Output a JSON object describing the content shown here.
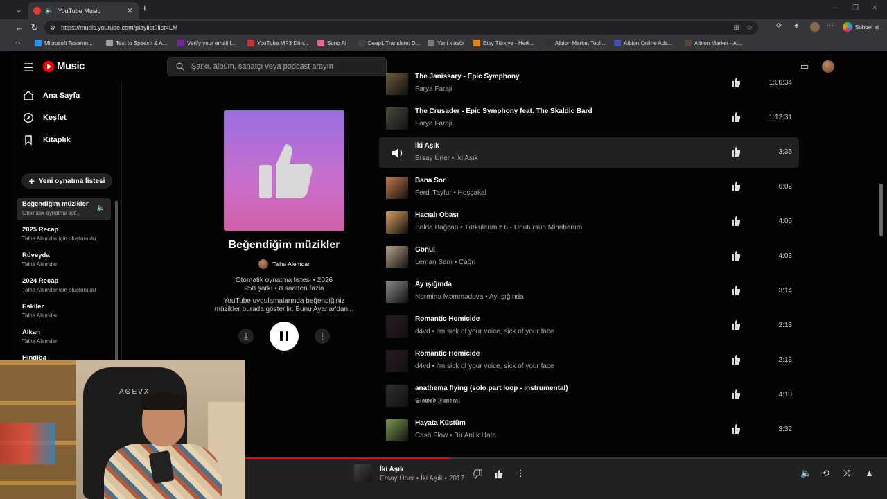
{
  "browser": {
    "tab_title": "YouTube Music",
    "url": "https://music.youtube.com/playlist?list=LM",
    "profile_label": "Sohbet et",
    "bookmarks": [
      {
        "label": "Microsoft Tasarım...",
        "color": "#2196f3"
      },
      {
        "label": "Text to Speech & A...",
        "color": "#9e9e9e"
      },
      {
        "label": "Verify your email f...",
        "color": "#7b1fa2"
      },
      {
        "label": "YouTube MP3 Dön...",
        "color": "#d32f2f"
      },
      {
        "label": "Suno AI",
        "color": "#f06292"
      },
      {
        "label": "DeepL Translate: D...",
        "color": "#424242"
      },
      {
        "label": "Yeni klasör",
        "color": "#757575"
      },
      {
        "label": "Etsy Türkiye - Herk...",
        "color": "#f57c00"
      },
      {
        "label": "Albion Market Tool...",
        "color": "#303030"
      },
      {
        "label": "Albion Online Ada...",
        "color": "#3f51b5"
      },
      {
        "label": "Albion Market - Al...",
        "color": "#5d4037"
      }
    ]
  },
  "app": {
    "logo_text": "Music",
    "search_placeholder": "Şarkı, albüm, sanatçı veya podcast arayın",
    "nav": [
      {
        "label": "Ana Sayfa",
        "icon": "home-icon"
      },
      {
        "label": "Keşfet",
        "icon": "explore-icon"
      },
      {
        "label": "Kitaplık",
        "icon": "library-icon"
      }
    ],
    "new_playlist_label": "Yeni oynatma listesi",
    "playlists": [
      {
        "title": "Beğendiğim müzikler",
        "subtitle": "Otomatik oynatma list...",
        "active": true
      },
      {
        "title": "2025 Recap",
        "subtitle": "Talha Alemdar için oluşturuldu"
      },
      {
        "title": "Rüveyda",
        "subtitle": "Talha Alemdar"
      },
      {
        "title": "2024 Recap",
        "subtitle": "Talha Alemdar için oluşturuldu"
      },
      {
        "title": "Eskiler",
        "subtitle": "Talha Alemdar"
      },
      {
        "title": "Alkan",
        "subtitle": "Talha Alemdar"
      },
      {
        "title": "Hindiba",
        "subtitle": ""
      }
    ]
  },
  "playlist": {
    "title": "Beğendiğim müzikler",
    "owner": "Talha Alemdar",
    "meta_line1": "Otomatik oynatma listesi • 2026",
    "meta_line2": "958 şarkı • 8 saatten fazla",
    "description_line1": "YouTube uygulamalarında beğendiğiniz",
    "description_line2": "müzikler burada gösterilir. Bunu Ayarlar'dan..."
  },
  "tracks": [
    {
      "title": "The Janissary - Epic Symphony",
      "artist": "Farya Faraji",
      "duration": "1:00:34",
      "color": "#6b5a3a"
    },
    {
      "title": "The Crusader - Epic Symphony feat. The Skaldic Bard",
      "artist": "Farya Faraji",
      "duration": "1:12:31",
      "color": "#4a4a3e"
    },
    {
      "title": "İki Aşık",
      "artist": "Ersay Üner • İki Aşık",
      "duration": "3:35",
      "color": "#222222",
      "active": true
    },
    {
      "title": "Bana Sor",
      "artist": "Ferdi Tayfur • Hoşçakal",
      "duration": "6:02",
      "color": "#c47a4a"
    },
    {
      "title": "Hacıalı Obası",
      "artist": "Selda Bağcan • Türkülerimiz 6 - Unutursun Mihribanım",
      "duration": "4:06",
      "color": "#d99d5a"
    },
    {
      "title": "Gönül",
      "artist": "Leman Sam • Çağrı",
      "duration": "4:03",
      "color": "#b8a48a"
    },
    {
      "title": "Ay ışığında",
      "artist": "Nərminə Məmmədova • Ay ışığında",
      "duration": "3:14",
      "color": "#8a8a8a"
    },
    {
      "title": "Romantic Homicide",
      "artist": "d4vd • i'm sick of your voice, sick of your face",
      "duration": "2:13",
      "color": "#2a1a24"
    },
    {
      "title": "Romantic Homicide",
      "artist": "d4vd • i'm sick of your voice, sick of your face",
      "duration": "2:13",
      "color": "#2a1a24"
    },
    {
      "title": "anathema flying (solo part loop - instrumental)",
      "artist": "𝕾𝖑𝖔𝖜𝖊𝖉 𝕱𝖚𝖓𝖊𝖗𝖆𝖑",
      "duration": "4:10",
      "color": "#2e2e2e"
    },
    {
      "title": "Hayata Küstüm",
      "artist": "Cash Flow • Bir Anlık Hata",
      "duration": "3:32",
      "color": "#7a9a4a"
    }
  ],
  "player": {
    "title": "İki Aşık",
    "subtitle": "Ersay Üner • İki Aşık • 2017",
    "progress": 0.5
  },
  "webcam": {
    "chair_brand": "AΘEVX"
  }
}
